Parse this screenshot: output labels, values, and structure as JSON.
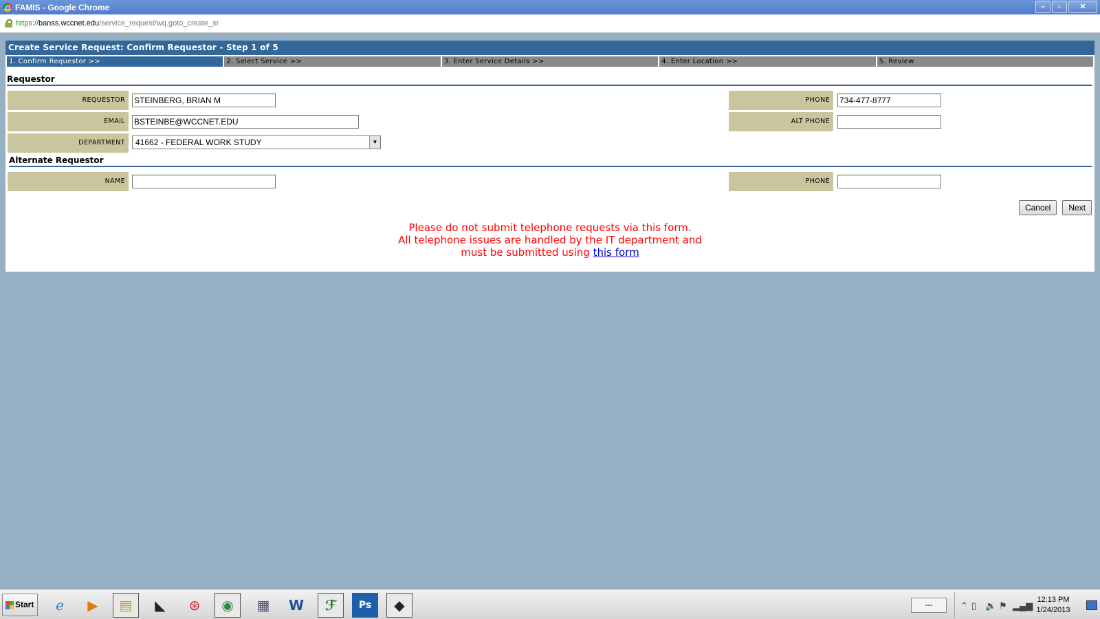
{
  "window": {
    "title": "FAMIS - Google Chrome",
    "minimize": "–",
    "maximize": "▫",
    "close": "✕"
  },
  "address": {
    "scheme": "https://",
    "host": "banss.wccnet.edu",
    "path": "/service_request/wq.goto_create_sr"
  },
  "page": {
    "header": "Create Service Request: Confirm Requestor - Step 1 of 5",
    "steps": [
      "1. Confirm Requestor >>",
      "2. Select Service >>",
      "3. Enter Service Details >>",
      "4. Enter Location >>",
      "5. Review"
    ],
    "requestor_section": "Requestor",
    "alternate_section": "Alternate Requestor",
    "labels": {
      "requestor": "REQUESTOR",
      "email": "EMAIL",
      "department": "DEPARTMENT",
      "phone": "PHONE",
      "alt_phone": "ALT PHONE",
      "name": "NAME",
      "alt_req_phone": "PHONE"
    },
    "values": {
      "requestor": "STEINBERG, BRIAN M",
      "email": "BSTEINBE@WCCNET.EDU",
      "department": "41662 - FEDERAL WORK STUDY",
      "phone": "734-477-8777",
      "alt_phone": "",
      "name": "",
      "alt_req_phone": ""
    },
    "buttons": {
      "cancel": "Cancel",
      "next": "Next"
    },
    "notice": {
      "line1": "Please do not submit telephone requests via this form.",
      "line2": "All telephone issues are handled by the IT department and",
      "line3": "must be submitted using",
      "link": "this form"
    }
  },
  "taskbar": {
    "start": "Start",
    "lang": "---",
    "time": "12:13 PM",
    "date": "1/24/2013"
  },
  "colors": {
    "accent": "#336699",
    "label_bg": "#c9c59d",
    "desktop": "#97b1c4",
    "notice": "#ff0000"
  }
}
